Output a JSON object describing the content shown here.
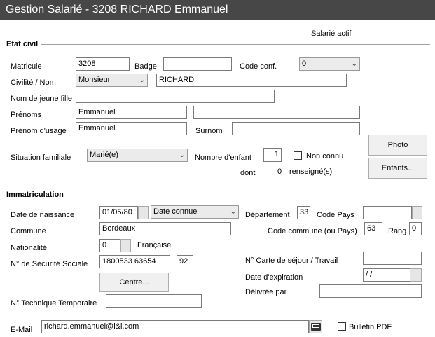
{
  "window": {
    "title": "Gestion Salarié - 3208 RICHARD Emmanuel"
  },
  "status": {
    "label": "Salarié actif"
  },
  "etat_civil": {
    "section_title": "Etat civil",
    "matricule_label": "Matricule",
    "matricule_value": "3208",
    "badge_label": "Badge",
    "badge_value": "",
    "code_conf_label": "Code conf.",
    "code_conf_value": "0",
    "civilite_label": "Civilité /  Nom",
    "civilite_value": "Monsieur",
    "nom_value": "RICHARD",
    "nom_jeune_fille_label": "Nom de jeune fille",
    "nom_jeune_fille_value": "",
    "prenoms_label": "Prénoms",
    "prenoms_value": "Emmanuel",
    "prenoms2_value": "",
    "prenom_usage_label": "Prénom d'usage",
    "prenom_usage_value": "Emmanuel",
    "surnom_label": "Surnom",
    "surnom_value": "",
    "situation_label": "Situation familiale",
    "situation_value": "Marié(e)",
    "nb_enfant_label": "Nombre d'enfant",
    "nb_enfant_value": "1",
    "non_connu_label": "Non connu",
    "dont_label": "dont",
    "dont_value": "0",
    "renseigne_label": "renseigné(s)",
    "photo_button": "Photo",
    "enfants_button": "Enfants..."
  },
  "immatriculation": {
    "section_title": "Immatriculation",
    "date_naissance_label": "Date de naissance",
    "date_naissance_value": "01/05/80",
    "date_connue_value": "Date connue",
    "departement_label": "Département",
    "departement_value": "33",
    "code_pays_label": "Code Pays",
    "code_pays_value": "",
    "commune_label": "Commune",
    "commune_value": "Bordeaux",
    "code_commune_label": "Code commune (ou Pays)",
    "code_commune_value": "63",
    "rang_label": "Rang",
    "rang_value": "0",
    "nationalite_label": "Nationalité",
    "nationalite_code": "0",
    "nationalite_text": "Française",
    "secu_label": "N° de Sécurité Sociale",
    "secu_value": "1800533 63654",
    "secu_key": "92",
    "carte_sejour_label": "N° Carte de séjour / Travail",
    "carte_sejour_value": "",
    "date_expiration_label": "Date d'expiration",
    "date_expiration_value": " /  /",
    "centre_button": "Centre...",
    "delivree_label": "Délivrée par",
    "delivree_value": "",
    "technique_label": "N° Technique Temporaire",
    "technique_value": "",
    "email_label": "E-Mail",
    "email_value": "richard.emmanuel@i&i.com",
    "bulletin_label": "Bulletin PDF"
  }
}
